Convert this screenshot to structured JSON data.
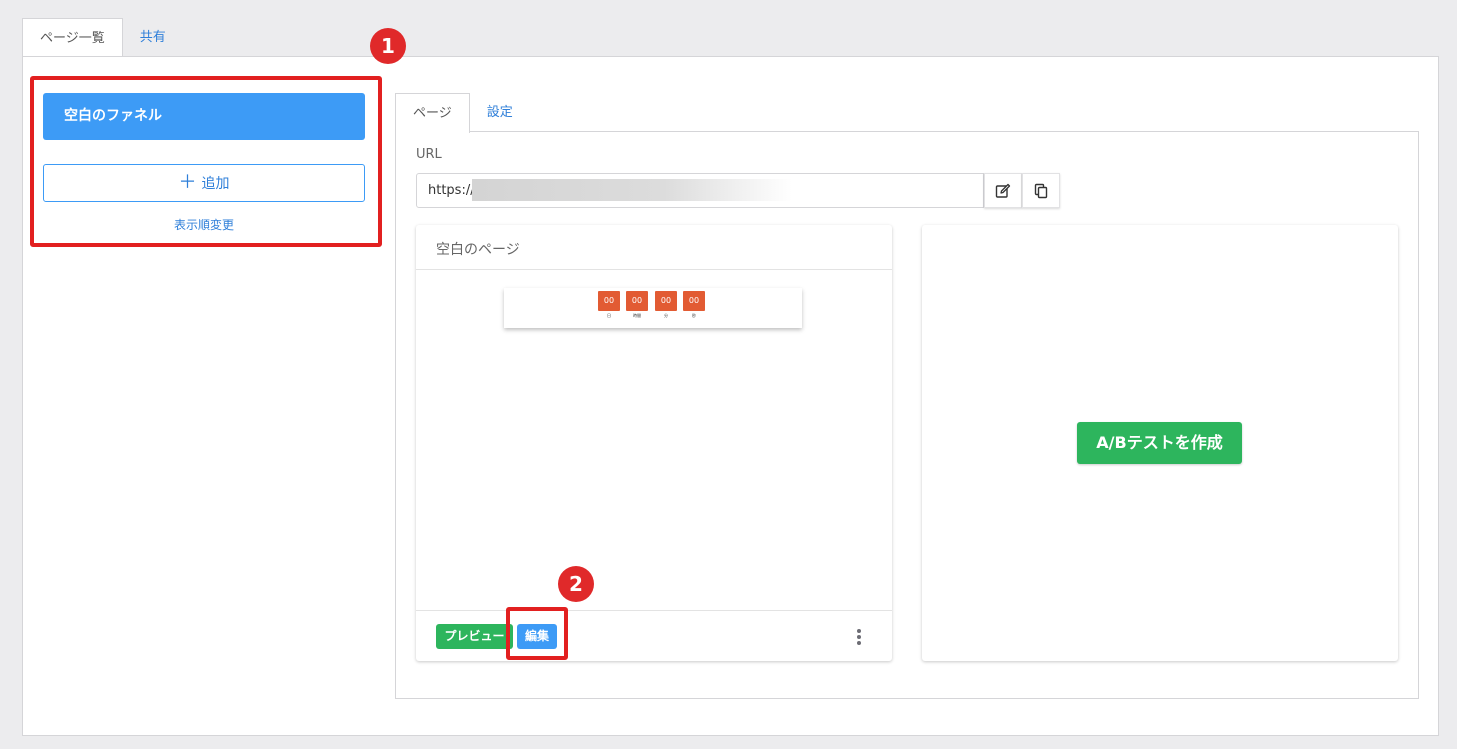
{
  "top_tabs": [
    {
      "label": "ページ一覧",
      "active": true
    },
    {
      "label": "共有",
      "active": false
    }
  ],
  "funnel_list": {
    "selected_label": "空白のファネル",
    "add_label": "追加",
    "reorder_label": "表示順変更"
  },
  "badges": {
    "one": "1",
    "two": "2"
  },
  "inner_tabs": [
    {
      "label": "ページ",
      "active": true
    },
    {
      "label": "設定",
      "active": false
    }
  ],
  "url": {
    "label": "URL",
    "value": "https://"
  },
  "icons": {
    "edit": "edit-pencil-icon",
    "copy": "copy-icon",
    "more": "more-vertical-icon"
  },
  "page_card": {
    "title": "空白のページ",
    "countdown": [
      {
        "value": "00",
        "label": "日"
      },
      {
        "value": "00",
        "label": "時間"
      },
      {
        "value": "00",
        "label": "分"
      },
      {
        "value": "00",
        "label": "秒"
      }
    ],
    "preview_label": "プレビュー",
    "edit_label": "編集"
  },
  "ab_test": {
    "button_label": "A/Bテストを作成"
  },
  "colors": {
    "primary": "#3d9bf6",
    "success": "#2db55d",
    "highlight": "#e22020",
    "countdown": "#e25b33"
  }
}
